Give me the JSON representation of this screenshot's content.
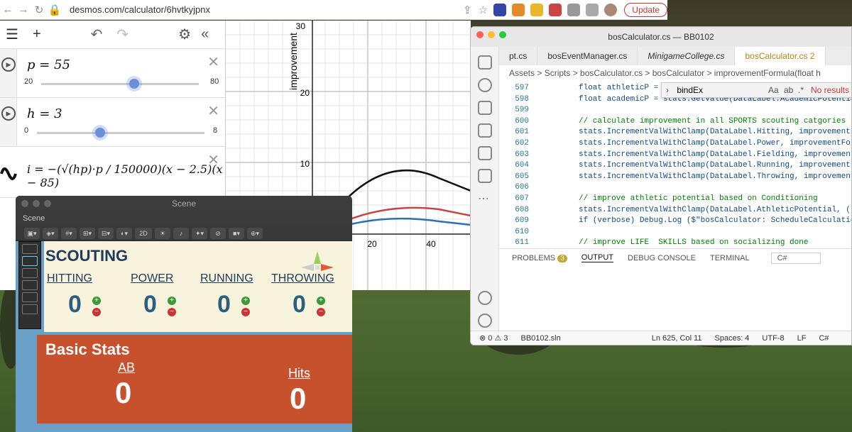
{
  "browser": {
    "url": "desmos.com/calculator/6hvtkyjpnx",
    "update_label": "Update"
  },
  "desmos": {
    "expressions": [
      {
        "latex": "p = 55",
        "min": "20",
        "max": "80",
        "value": 55
      },
      {
        "latex": "h = 3",
        "min": "0",
        "max": "8",
        "value": 3
      },
      {
        "latex": "i = −(√(hp)·p / 150000)(x − 2.5)(x − 85)"
      }
    ],
    "graph": {
      "ylabel": "improvement",
      "yticks": [
        "30",
        "20",
        "10"
      ],
      "xticks": [
        "20",
        "40"
      ]
    }
  },
  "unity": {
    "window_title": "Scene",
    "tab_label": "Scene",
    "tool_2d": "2D",
    "scouting_title": "SCOUTING",
    "categories": [
      {
        "name": "HITTING",
        "value": "0"
      },
      {
        "name": "POWER",
        "value": "0"
      },
      {
        "name": "RUNNING",
        "value": "0"
      },
      {
        "name": "THROWING",
        "value": "0"
      }
    ],
    "basic_title": "Basic Stats",
    "basic": [
      {
        "name": "AB",
        "value": "0"
      },
      {
        "name": "Hits",
        "value": "0"
      }
    ]
  },
  "vscode": {
    "window_title": "bosCalculator.cs — BB0102",
    "tabs": [
      "pt.cs",
      "bosEventManager.cs",
      "MinigameCollege.cs",
      "bosCalculator.cs 2"
    ],
    "breadcrumb": "Assets > Scripts > bosCalculator.cs > bosCalculator > improvementFormula(float h",
    "find_value": "bindEx",
    "find_result": "No results",
    "lines": [
      {
        "n": "597",
        "t": "float athleticP = s"
      },
      {
        "n": "598",
        "t": "float academicP = stats.GetValue(DataLabel.AcademicPotential"
      },
      {
        "n": "599",
        "t": ""
      },
      {
        "n": "600",
        "t": "// calculate improvement in all SPORTS scouting catgories",
        "c": true
      },
      {
        "n": "601",
        "t": "stats.IncrementValWithClamp(DataLabel.Hitting, improvementFormu"
      },
      {
        "n": "602",
        "t": "stats.IncrementValWithClamp(DataLabel.Power, improvementFormula"
      },
      {
        "n": "603",
        "t": "stats.IncrementValWithClamp(DataLabel.Fielding, improvementForm"
      },
      {
        "n": "604",
        "t": "stats.IncrementValWithClamp(DataLabel.Running, improvementForm"
      },
      {
        "n": "605",
        "t": "stats.IncrementValWithClamp(DataLabel.Throwing, improvementForm"
      },
      {
        "n": "606",
        "t": ""
      },
      {
        "n": "607",
        "t": "// improve athletic potential based on Conditioning",
        "c": true
      },
      {
        "n": "608",
        "t": "stats.IncrementValWithClamp(DataLabel.AthleticPotential, (stat"
      },
      {
        "n": "609",
        "t": "if (verbose) Debug.Log ($\"bosCalculator: ScheduleCalculation()"
      },
      {
        "n": "610",
        "t": ""
      },
      {
        "n": "611",
        "t": "// improve LIFE  SKILLS based on socializing done",
        "c": true
      }
    ],
    "panel_tabs": [
      "PROBLEMS",
      "OUTPUT",
      "DEBUG CONSOLE",
      "TERMINAL"
    ],
    "problems_count": "3",
    "output_filter": "C#",
    "status": {
      "errors": "⊗ 0 ⚠ 3",
      "project": "BB0102.sln",
      "pos": "Ln 625, Col 11",
      "spaces": "Spaces: 4",
      "enc": "UTF-8",
      "eol": "LF",
      "lang": "C#"
    }
  }
}
